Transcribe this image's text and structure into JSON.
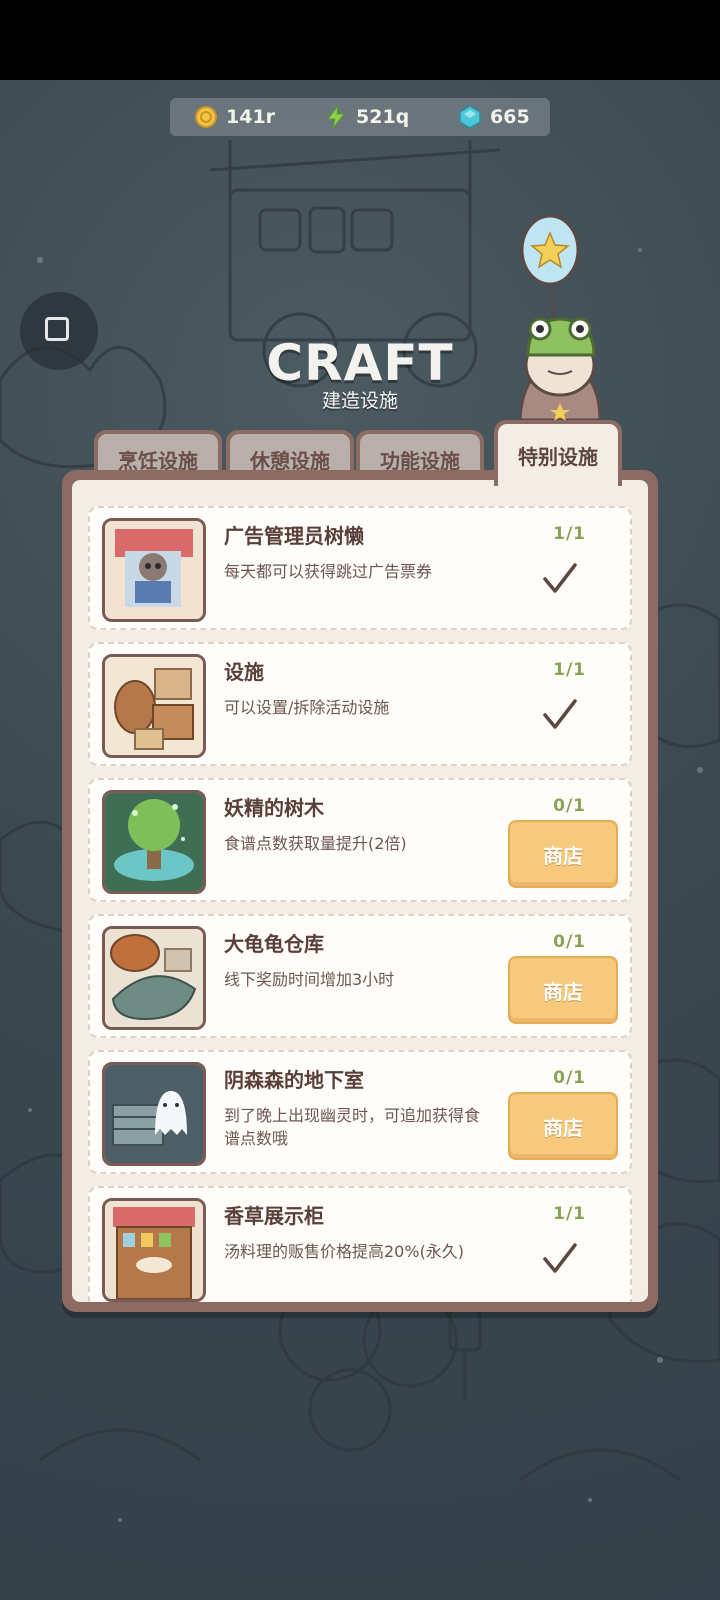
{
  "currency": {
    "coins": "141r",
    "energy": "521q",
    "gems": "665"
  },
  "header": {
    "title": "CRAFT",
    "subtitle": "建造设施"
  },
  "tabs": [
    {
      "label": "烹饪设施",
      "active": false
    },
    {
      "label": "休憩设施",
      "active": false
    },
    {
      "label": "功能设施",
      "active": false
    },
    {
      "label": "特别设施",
      "active": true
    }
  ],
  "items": [
    {
      "name": "广告管理员树懒",
      "desc": "每天都可以获得跳过广告票券",
      "count": "1/1",
      "owned": true
    },
    {
      "name": "设施",
      "desc": "可以设置/拆除活动设施",
      "count": "1/1",
      "owned": true
    },
    {
      "name": "妖精的树木",
      "desc": "食谱点数获取量提升(2倍)",
      "count": "0/1",
      "owned": false,
      "button": "商店"
    },
    {
      "name": "大龟龟仓库",
      "desc": "线下奖励时间增加3小时",
      "count": "0/1",
      "owned": false,
      "button": "商店"
    },
    {
      "name": "阴森森的地下室",
      "desc": "到了晚上出现幽灵时，可追加获得食谱点数哦",
      "count": "0/1",
      "owned": false,
      "button": "商店"
    },
    {
      "name": "香草展示柜",
      "desc": "汤料理的贩售价格提高20%(永久)",
      "count": "1/1",
      "owned": true
    }
  ],
  "colors": {
    "panel_border": "#8b6b62",
    "panel_bg": "#f3ede5",
    "count_green": "#8aa35a",
    "shop_button": "#f6c97c"
  }
}
